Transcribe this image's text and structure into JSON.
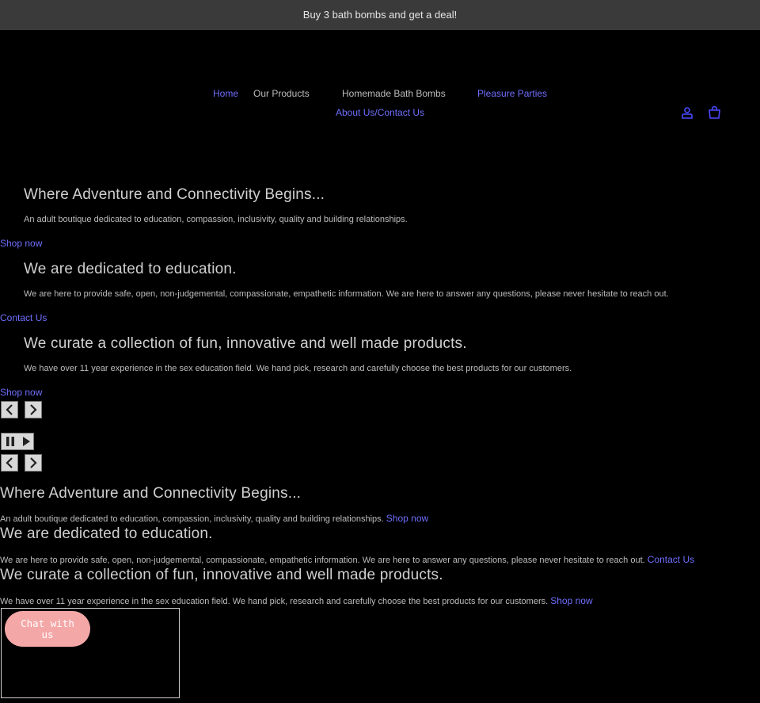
{
  "announcement": "Buy 3 bath bombs and get a deal!",
  "nav": {
    "home": "Home",
    "our_products": "Our Products",
    "bath_bombs": "Homemade Bath Bombs",
    "pleasure_parties": "Pleasure Parties",
    "about_contact": "About Us/Contact Us"
  },
  "header_icons": {
    "account": "account-icon",
    "cart": "cart-icon"
  },
  "slides": [
    {
      "heading": "Where Adventure and Connectivity Begins...",
      "text": "An adult boutique dedicated to education, compassion, inclusivity, quality and building relationships.",
      "link": "Shop now"
    },
    {
      "heading": "We are dedicated to education.",
      "text": "We are here to provide safe, open, non-judgemental, compassionate, empathetic information. We are here to answer any questions, please never hesitate to reach out.",
      "link": "Contact Us"
    },
    {
      "heading": "We curate a collection of fun, innovative and well made products.",
      "text": "We have over 11 year experience in the sex education field. We hand pick, research and carefully choose the best products for our customers.",
      "link": "Shop now"
    }
  ],
  "controls": {
    "prev": "chevron-left-icon",
    "next": "chevron-right-icon",
    "pause": "pause-icon",
    "play": "play-icon"
  },
  "chat": {
    "label": "Chat with us"
  },
  "colors": {
    "background": "#000000",
    "announcement_bg": "#3a3a3a",
    "link": "#6f6fff",
    "chat_button": "#f4a7a7"
  }
}
